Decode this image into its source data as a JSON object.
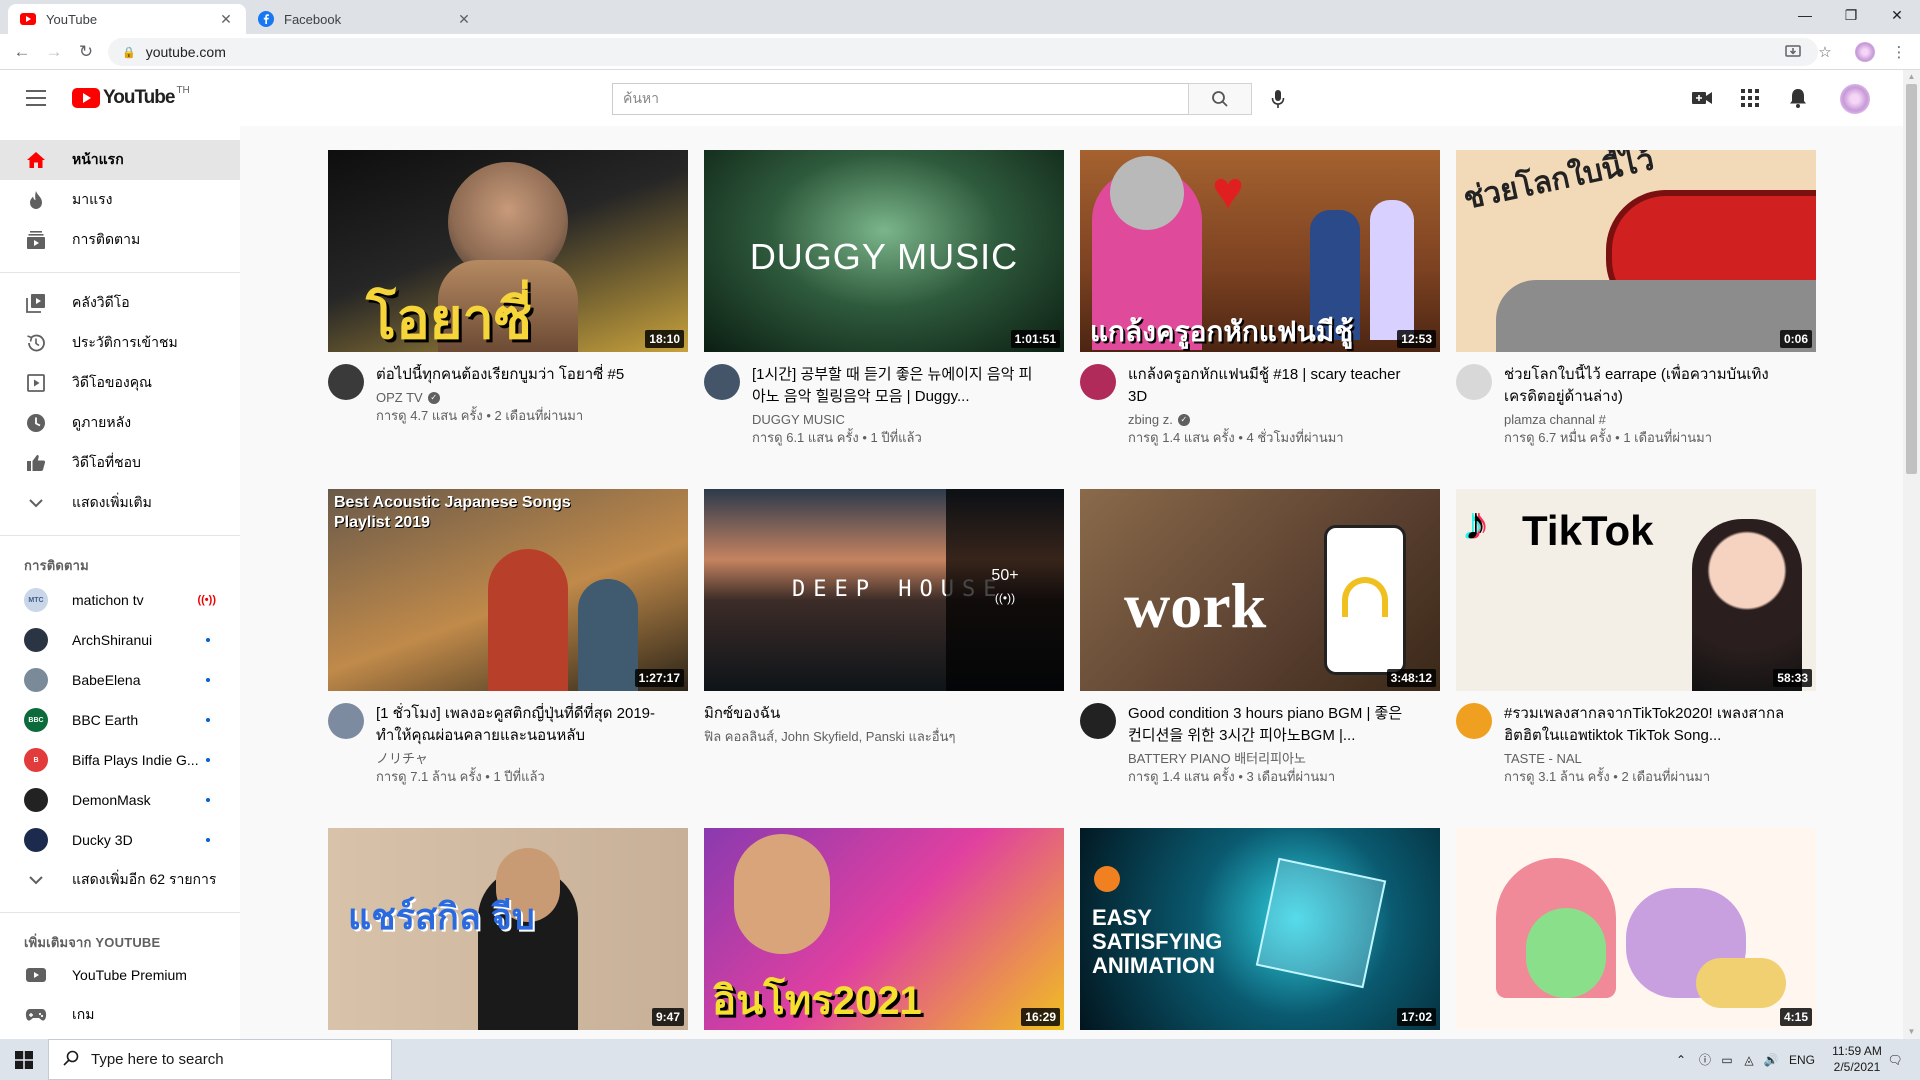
{
  "browser": {
    "tabs": [
      {
        "title": "YouTube",
        "close": "✕",
        "active": true
      },
      {
        "title": "Facebook",
        "close": "✕",
        "active": false
      }
    ],
    "address": "youtube.com"
  },
  "masthead": {
    "logo_text": "YouTube",
    "logo_region": "TH",
    "search_placeholder": "ค้นหา"
  },
  "sidebar": {
    "main_items": [
      {
        "label": "หน้าแรก",
        "icon": "home-icon",
        "active": true
      },
      {
        "label": "มาแรง",
        "icon": "trending-icon"
      },
      {
        "label": "การติดตาม",
        "icon": "subscriptions-icon"
      }
    ],
    "library_items": [
      {
        "label": "คลังวิดีโอ",
        "icon": "library-icon"
      },
      {
        "label": "ประวัติการเข้าชม",
        "icon": "history-icon"
      },
      {
        "label": "วิดีโอของคุณ",
        "icon": "your-videos-icon"
      },
      {
        "label": "ดูภายหลัง",
        "icon": "watch-later-icon"
      },
      {
        "label": "วิดีโอที่ชอบ",
        "icon": "liked-icon"
      },
      {
        "label": "แสดงเพิ่มเติม",
        "icon": "chevron-down-icon"
      }
    ],
    "subscriptions_heading": "การติดตาม",
    "subscriptions": [
      {
        "name": "matichon tv",
        "live": "((•))",
        "color": "#c9d6e8"
      },
      {
        "name": "ArchShiranui",
        "color": "#2a3442"
      },
      {
        "name": "BabeElena",
        "color": "#7b8a99"
      },
      {
        "name": "BBC Earth",
        "color": "#0b6b3a"
      },
      {
        "name": "Biffa Plays Indie G...",
        "color": "#e23b3b"
      },
      {
        "name": "DemonMask",
        "color": "#222222"
      },
      {
        "name": "Ducky 3D",
        "color": "#1c2b4d"
      }
    ],
    "show_more_subs": "แสดงเพิ่มอีก 62 รายการ",
    "more_heading": "เพิ่มเติมจาก YOUTUBE",
    "more_items": [
      {
        "label": "YouTube Premium",
        "icon": "youtube-premium-icon"
      },
      {
        "label": "เกม",
        "icon": "gaming-icon"
      }
    ]
  },
  "videos": [
    {
      "title": "ต่อไปนี้ทุกคนต้องเรียกบูมว่า โอยาซี่ #5",
      "channel": "OPZ TV",
      "verified": true,
      "stats": "การดู 4.7 แสน ครั้ง • 2 เดือนที่ผ่านมา",
      "duration": "18:10",
      "thumb_text": "โอยาซี่",
      "thumb_colors": [
        "#1a1a1a",
        "#c8a23c"
      ],
      "avatar_color": "#3a3a3a"
    },
    {
      "title": "[1시간] 공부할 때 듣기 좋은 뉴에이지 음악 피아노 음악 힐링음악 모음 | Duggy...",
      "channel": "DUGGY MUSIC",
      "verified": false,
      "stats": "การดู 6.1 แสน ครั้ง • 1 ปีที่แล้ว",
      "duration": "1:01:51",
      "thumb_text": "DUGGY MUSIC",
      "thumb_colors": [
        "#0f2a1a",
        "#6fa77a"
      ],
      "avatar_color": "#44556a"
    },
    {
      "title": "แกล้งครูอกหักแฟนมีชู้ #18 | scary teacher 3D",
      "channel": "zbing z.",
      "verified": true,
      "stats": "การดู 1.4 แสน ครั้ง • 4 ชั่วโมงที่ผ่านมา",
      "duration": "12:53",
      "thumb_text": "แกล้งครูอกหักแฟนมีชู้",
      "thumb_colors": [
        "#8a4a2a",
        "#e04a9a"
      ],
      "avatar_color": "#b02a5a"
    },
    {
      "title": "ช่วยโลกใบนี้ไว้ earrape (เพื่อความบันเทิงเครดิตอยู่ด้านล่าง)",
      "channel": "plamza channal #",
      "verified": false,
      "stats": "การดู 6.7 หมื่น ครั้ง • 1 เดือนที่ผ่านมา",
      "duration": "0:06",
      "thumb_text": "ช่วยโลกใบนี้ไว้",
      "thumb_colors": [
        "#f2d9b8",
        "#d02020"
      ],
      "avatar_color": "#d8d8d8"
    },
    {
      "title": "[1 ชั่วโมง] เพลงอะคูสติกญี่ปุ่นที่ดีที่สุด 2019- ทำให้คุณผ่อนคลายและนอนหลับ",
      "channel": "ノリチャ",
      "verified": false,
      "stats": "การดู 7.1 ล้าน ครั้ง • 1 ปีที่แล้ว",
      "duration": "1:27:17",
      "thumb_text": "Best Acoustic Japanese Songs Playlist 2019",
      "thumb_colors": [
        "#3a2a1a",
        "#e0a050"
      ],
      "avatar_color": "#7d8ba0"
    },
    {
      "title": "มิกซ์ของฉัน",
      "channel": "ฟิล คอลลินส์, John Skyfield, Panski และอื่นๆ",
      "verified": false,
      "stats": "",
      "duration": "",
      "thumb_text": "DEEP HOUSE",
      "mix_count": "50+",
      "mix_icon": "((•))",
      "thumb_colors": [
        "#2a3a4a",
        "#d28a5a"
      ],
      "avatar_color": ""
    },
    {
      "title": "Good condition 3 hours piano BGM | 좋은 컨디션을 위한 3시간 피아노BGM |...",
      "channel": "BATTERY PIANO 배터리피아노",
      "verified": false,
      "stats": "การดู 1.4 แสน ครั้ง • 3 เดือนที่ผ่านมา",
      "duration": "3:48:12",
      "thumb_text": "work",
      "thumb_colors": [
        "#5a4030",
        "#a08060"
      ],
      "avatar_color": "#222222"
    },
    {
      "title": "#รวมเพลงสากลจากTikTok2020! เพลงสากลฮิตฮิตในแอพtiktok TikTok Song...",
      "channel": "TASTE - NAL",
      "verified": false,
      "stats": "การดู 3.1 ล้าน ครั้ง • 2 เดือนที่ผ่านมา",
      "duration": "58:33",
      "thumb_text": "TikTok",
      "thumb_colors": [
        "#f4efe6",
        "#e0b0b0"
      ],
      "avatar_color": "#f0a020"
    },
    {
      "title": "",
      "channel": "",
      "verified": false,
      "stats": "",
      "duration": "9:47",
      "thumb_text": "แชร์สกิล จีบ",
      "thumb_colors": [
        "#d8c0a8",
        "#2a6ae0"
      ],
      "avatar_color": ""
    },
    {
      "title": "",
      "channel": "",
      "verified": false,
      "stats": "",
      "duration": "16:29",
      "thumb_text": "อินโทร2021",
      "thumb_colors": [
        "#e040a0",
        "#f0c020"
      ],
      "avatar_color": ""
    },
    {
      "title": "",
      "channel": "",
      "verified": false,
      "stats": "",
      "duration": "17:02",
      "thumb_text": "EASY SATISFYING ANIMATION",
      "thumb_colors": [
        "#042a3a",
        "#30d0e0"
      ],
      "avatar_color": ""
    },
    {
      "title": "",
      "channel": "",
      "verified": false,
      "stats": "",
      "duration": "4:15",
      "thumb_text": "",
      "thumb_colors": [
        "#fff6f0",
        "#f0a0b0"
      ],
      "avatar_color": ""
    }
  ],
  "taskbar": {
    "search_placeholder": "Type here to search",
    "language": "ENG",
    "time": "11:59 AM",
    "date": "2/5/2021"
  }
}
